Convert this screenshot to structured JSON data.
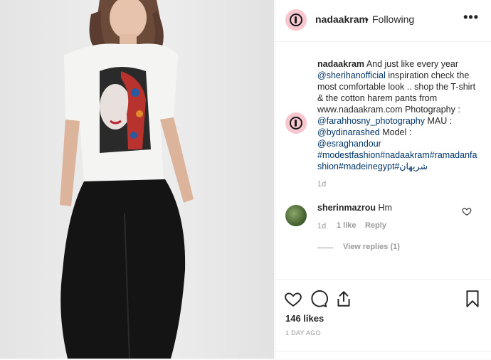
{
  "header": {
    "username": "nadaakram",
    "separator": "•",
    "follow_status": "Following",
    "more_label": "•••"
  },
  "caption": {
    "username": "nadaakram",
    "text_1": "And just like every year",
    "mention_1": "@sherihanofficial",
    "text_2": "inspiration check the most comfortable look .. shop the T-shirt & the cotton harem pants from www.nadaakram.com Photography :",
    "mention_2": "@farahhosny_photography",
    "text_3": "MAU :",
    "mention_3": "@bydinarashed",
    "text_4": "Model :",
    "mention_4": "@esraghandour",
    "hashtags": "#modestfashion#nadaakram#ramadanfashion#madeinegypt#شريهان",
    "age": "1d"
  },
  "comment": {
    "username": "sherinmazrou",
    "text": "Hm",
    "age": "1d",
    "likes": "1 like",
    "reply_label": "Reply",
    "view_replies": "View replies (1)"
  },
  "actions": {
    "likes_count": "146 likes",
    "post_age": "1 DAY AGO"
  },
  "colors": {
    "link": "#003569",
    "muted": "#999999",
    "text": "#262626",
    "avatar_bg": "#f7c6cf"
  }
}
